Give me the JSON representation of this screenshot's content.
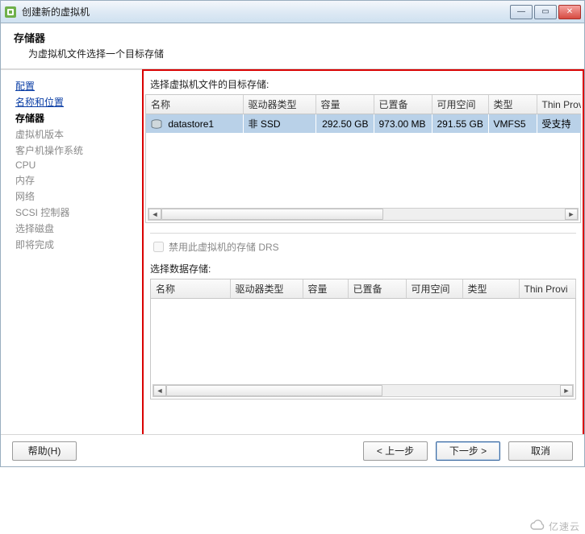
{
  "window": {
    "title": "创建新的虚拟机"
  },
  "header": {
    "title": "存储器",
    "subtitle": "为虚拟机文件选择一个目标存储"
  },
  "sidebar": {
    "items": [
      {
        "label": "配置",
        "kind": "link"
      },
      {
        "label": "名称和位置",
        "kind": "link"
      },
      {
        "label": "存储器",
        "kind": "active"
      },
      {
        "label": "虚拟机版本",
        "kind": "normal"
      },
      {
        "label": "客户机操作系统",
        "kind": "normal"
      },
      {
        "label": "CPU",
        "kind": "normal"
      },
      {
        "label": "内存",
        "kind": "normal"
      },
      {
        "label": "网络",
        "kind": "normal"
      },
      {
        "label": "SCSI 控制器",
        "kind": "normal"
      },
      {
        "label": "选择磁盘",
        "kind": "normal"
      },
      {
        "label": "即将完成",
        "kind": "normal"
      }
    ]
  },
  "main": {
    "top_section_label": "选择虚拟机文件的目标存储:",
    "columns": {
      "name": "名称",
      "driver_type": "驱动器类型",
      "capacity": "容量",
      "provisioned": "已置备",
      "free": "可用空间",
      "type": "类型",
      "thin": "Thin Prov"
    },
    "rows": [
      {
        "name": "datastore1",
        "driver_type": "非 SSD",
        "capacity": "292.50 GB",
        "provisioned": "973.00 MB",
        "free": "291.55 GB",
        "type": "VMFS5",
        "thin": "受支持"
      }
    ],
    "disable_drs_label": "禁用此虚拟机的存储 DRS",
    "bottom_section_label": "选择数据存储:",
    "bottom_columns": {
      "name": "名称",
      "driver_type": "驱动器类型",
      "capacity": "容量",
      "provisioned": "已置备",
      "free": "可用空间",
      "type": "类型",
      "thin": "Thin Provi"
    }
  },
  "footer": {
    "help": "帮助(H)",
    "back": "< 上一步",
    "next": "下一步 >",
    "cancel": "取消"
  },
  "watermark": "亿速云"
}
